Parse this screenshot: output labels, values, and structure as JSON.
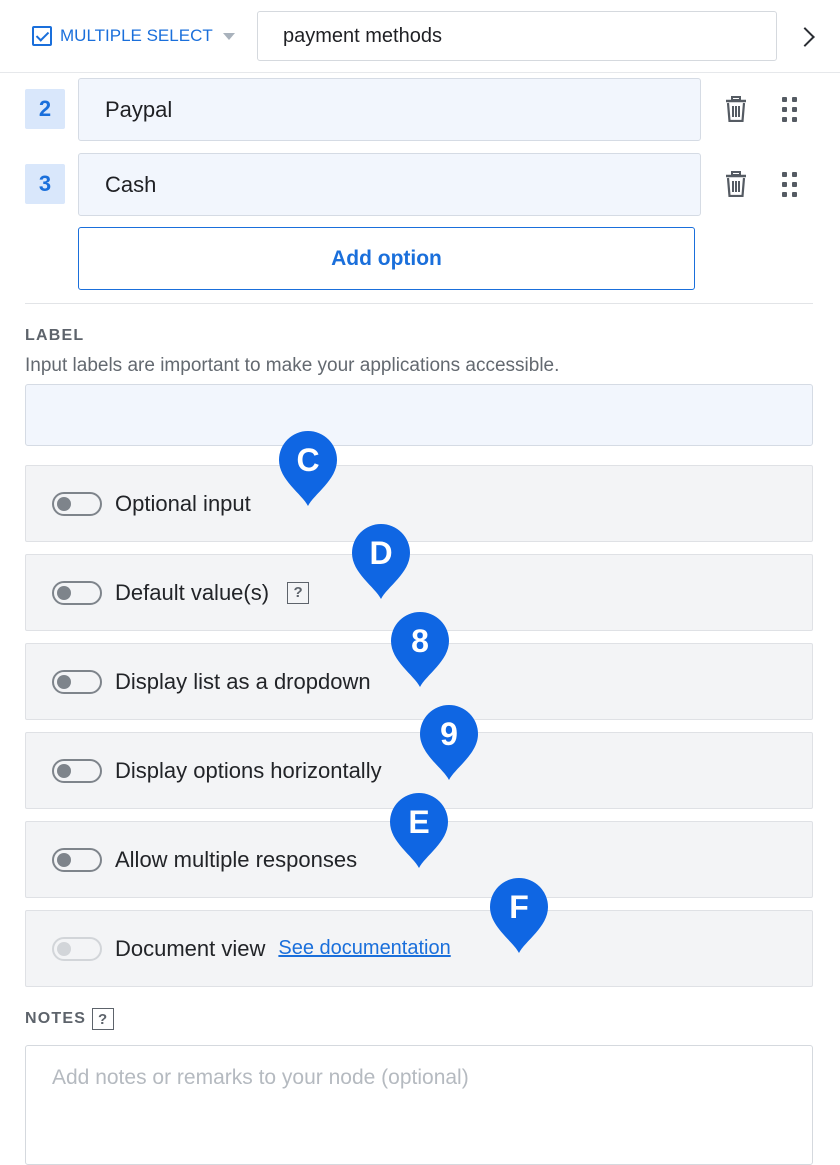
{
  "header": {
    "type_label": "MULTIPLE SELECT",
    "name_value": "payment methods"
  },
  "options": [
    {
      "number": "2",
      "value": "Paypal"
    },
    {
      "number": "3",
      "value": "Cash"
    }
  ],
  "add_option_label": "Add option",
  "label_section": {
    "heading": "LABEL",
    "help": "Input labels are important to make your applications accessible.",
    "value": ""
  },
  "toggles": [
    {
      "label": "Optional input",
      "on": false,
      "marker": "C"
    },
    {
      "label": "Default value(s)",
      "on": false,
      "marker": "D",
      "help_icon": "?"
    },
    {
      "label": "Display list as a dropdown",
      "on": false,
      "marker": "8"
    },
    {
      "label": "Display options horizontally",
      "on": false,
      "marker": "9"
    },
    {
      "label": "Allow multiple responses",
      "on": false,
      "marker": "E"
    },
    {
      "label": "Document view",
      "on": false,
      "disabled": true,
      "marker": "F",
      "link": "See documentation"
    }
  ],
  "notes": {
    "heading": "NOTES",
    "help_icon": "?",
    "placeholder": "Add notes or remarks to your node (optional)"
  },
  "colors": {
    "accent": "#1a6fdb",
    "marker": "#0f66e3",
    "row_bg": "#f3f4f6",
    "input_bg": "#f2f6fd"
  },
  "icons": [
    "checkbox-icon",
    "caret-down-icon",
    "chevron-right-icon",
    "trash-icon",
    "drag-handle-icon",
    "help-icon",
    "map-pin-icon"
  ]
}
